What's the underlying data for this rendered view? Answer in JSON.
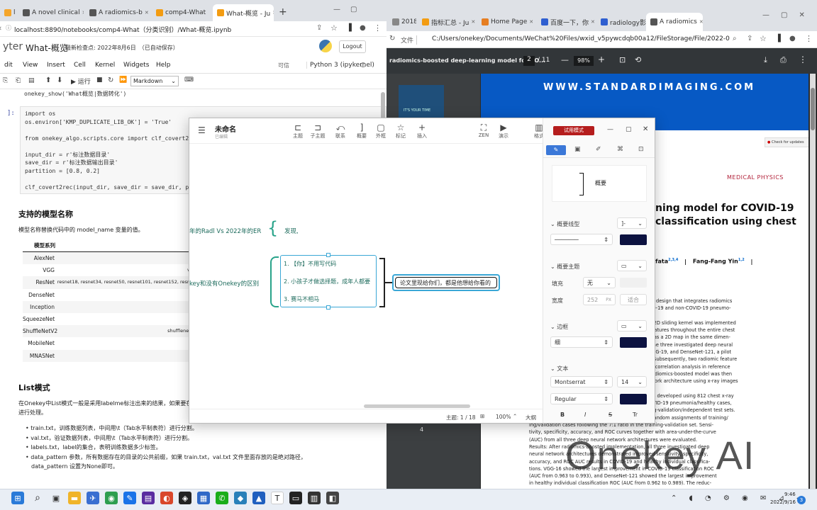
{
  "left_browser": {
    "tabs": [
      {
        "label": "l",
        "color": "#f4a52a"
      },
      {
        "label": "A novel clinical",
        "color": "#555"
      },
      {
        "label": "A radiomics-b",
        "color": "#555"
      },
      {
        "label": "comp4-What",
        "color": "#f39c12"
      },
      {
        "label": "What-概览 - Ju",
        "color": "#f39c12"
      }
    ],
    "new_tab": "+",
    "url": "localhost:8890/notebooks/comp4-What（分类识别）/What-概览.ipynb"
  },
  "jupyter": {
    "logo_text": "yter",
    "notebook_title": "What-概览",
    "checkpoint": "最新检查点: 2022年8月6日　（已自动保存）",
    "logout": "Logout",
    "menu": [
      "dit",
      "View",
      "Insert",
      "Cell",
      "Kernel",
      "Widgets",
      "Help"
    ],
    "trusted": "可信",
    "kernel": "Python 3 (ipykernel)",
    "run_label": "运行",
    "cell_type": "Markdown",
    "code_lines_top": [
      "onekey_show('What概览|数据转化')"
    ],
    "prompt": "]:",
    "code_lines": [
      "import os",
      "os.environ['KMP_DUPLICATE_LIB_OK'] = 'True'",
      "",
      "from onekey_algo.scripts.core import clf_covert2rec",
      "",
      "input_dir = r'标注数据目录'",
      "save_dir = r'标注数据输出目录'",
      "partition = [0.8, 0.2]",
      "",
      "clf_covert2rec(input_dir, save_dir = save_dir, partition"
    ],
    "models_heading": "支持的模型名称",
    "models_desc": "模型名称替换代码中的 model_name 变量的值。",
    "models_header": "模型系列",
    "models": [
      {
        "name": "AlexNet",
        "variants": ""
      },
      {
        "name": "VGG",
        "variants": "vg"
      },
      {
        "name": "ResNet",
        "variants": "resnet18, resnet34, resnet50, resnet101, resnet152, resne"
      },
      {
        "name": "DenseNet",
        "variants": ""
      },
      {
        "name": "Inception",
        "variants": ""
      },
      {
        "name": "SqueezeNet",
        "variants": ""
      },
      {
        "name": "ShuffleNetV2",
        "variants": "shufflenet_"
      },
      {
        "name": "MobileNet",
        "variants": ""
      },
      {
        "name": "MNASNet",
        "variants": ""
      }
    ],
    "list_heading": "List模式",
    "list_desc_1": "在Onekey中List模式一般是采用labelme标注出来的结果，如果要在",
    "list_desc_2": "进行处理。",
    "bullets": [
      "train.txt，训练数据列表，中间用\\t（Tab水平制表符）进行分割。",
      "val.txt，验证数据列表，中间用\\t（Tab水平制表符）进行分割。",
      "labels.txt，label的集合，表明训练数据多少标签。",
      "data_pattern 参数，所有数据存在的目录的公共前缀，如果 train.txt，val.txt 文件里面存放的是绝对路径，",
      "data_pattern 设置为None即可。"
    ]
  },
  "right_browser": {
    "tabs": [
      {
        "label": "2018",
        "color": "#888"
      },
      {
        "label": "指标汇总 - Ju",
        "color": "#f39c12"
      },
      {
        "label": "Home Page",
        "color": "#e67e22"
      },
      {
        "label": "百度一下，你",
        "color": "#2f5fd0"
      },
      {
        "label": "radiology影",
        "color": "#2f5fd0"
      },
      {
        "label": "A radiomics",
        "color": "#555"
      }
    ],
    "url_label": "文件",
    "url": "C:/Users/onekey/Documents/WeChat%20Files/wxid_v5pywcdqb00a12/FileStorage/File/2022-09/Medic..."
  },
  "pdf": {
    "doc_title": "radiomics-boosted deep-learning model for CO...",
    "page_current": "2",
    "page_total": "/ 11",
    "zoom": "98%",
    "thumb_text": "IT'S YOUR TIME",
    "thumb_page": "4",
    "banner": "WWW.STANDARDIMAGING.COM",
    "check_updates": "Check for updates",
    "journal": "MEDICAL PHYSICS",
    "title_line1": "ning model for COVID-19",
    "title_line2": "classification using chest",
    "author1": "fata",
    "author1_sup": "2,3,4",
    "author2": "Fang-Fang Yin",
    "author2_sup": "1,2",
    "abstract_lines": [
      "eep learning model design that integrates radiomics",
      "rformance of COVID-19 and non-COVID-19 pneumo-",
      "x-ray images.",
      "omics approach, a 2D sliding kernel was implemented",
      "onse of radiomic features throughout the entire chest",
      "eature is rendered as a 2D map in the same dimen-",
      "Based on each of the three investigated deep neural",
      "cluding VGG-16, VGG-19, and DenseNet-121, a pilot",
      "x-ray images only. Subsequently, two radiomic feature",
      "ted based on cross-correlation analysis in reference",
      "map results. The radiomics-boosted model was then",
      "e deep neural network architecture using x-ray images",
      "s input.",
      "boosted design was developed using 812 chest x-ray",
      "(COVID-19/non-COVID-19 pneumonia/healthy cases,",
      "assigned as training-validation/independent test sets.",
      "were trained with random assignments of training/",
      "ing/validation cases following the 7:1 ratio in the training-validation set. Sensi-",
      "tivity, specificity, accuracy, and ROC curves together with area-under-the-curve",
      "(AUC) from all three deep neural network architectures were evaluated.",
      "Results: After radiomics-boosted implementation, all three investigated deep",
      "neural network architectures demonstrated improved sensitivity, specificity,",
      "accuracy, and ROC AUC results in COVID-19 and healthy individual classifica-",
      "tions. VGG-16 showed the largest improvement in COVID-19 classification ROC",
      "(AUC from 0.963 to 0.993), and DenseNet-121 showed the largest improvement",
      "in healthy individual classification ROC (AUC from 0.962 to 0.989). The reduc-"
    ],
    "watermark": "Onekey AI"
  },
  "mindmap": {
    "title": "未命名",
    "subtitle": "已编辑",
    "toolbar": [
      {
        "label": "主题",
        "icon": "⊏"
      },
      {
        "label": "子主题",
        "icon": "⊐"
      },
      {
        "label": "联系",
        "icon": "⤺"
      },
      {
        "label": "概要",
        "icon": "]"
      },
      {
        "label": "外框",
        "icon": "▢"
      },
      {
        "label": "标记",
        "icon": "☆"
      },
      {
        "label": "插入",
        "icon": "+"
      },
      {
        "label": "ZEN",
        "icon": "⛶"
      },
      {
        "label": "演示",
        "icon": "▶"
      },
      {
        "label": "格式",
        "icon": "▥"
      }
    ],
    "trial_button": "试用模式",
    "node_top_left": "年的Radl Vs 2022年的ER",
    "node_top_right": "发现,",
    "node_mid_left": "key和没有Onekey的区别",
    "children": [
      "1. 【你】不用写代码",
      "2. 小孩子才做选择题，成年人都要",
      "3. 赛马不相马"
    ],
    "summary_node": "论文里现给你们，都是他想给你看的",
    "status_topic": "主题: 1 / 18",
    "status_zoom": "100%",
    "status_size": "大纲"
  },
  "format_panel": {
    "preview_label": "概要",
    "summary_line_title": "概要线型",
    "summary_theme_title": "概要主题",
    "fill_label": "填充",
    "fill_value": "无",
    "width_label": "宽度",
    "width_value": "252",
    "width_unit": "PX",
    "width_fit": "适合",
    "border_title": "边框",
    "border_value": "细",
    "text_title": "文本",
    "font_name": "Montserrat",
    "font_size": "14",
    "font_weight": "Regular",
    "text_buttons": [
      "B",
      "I",
      "S",
      "Tr"
    ],
    "accent_color": "#0c1240"
  },
  "taskbar": {
    "time": "9:46",
    "date": "2022/9/16",
    "badge": "3"
  }
}
